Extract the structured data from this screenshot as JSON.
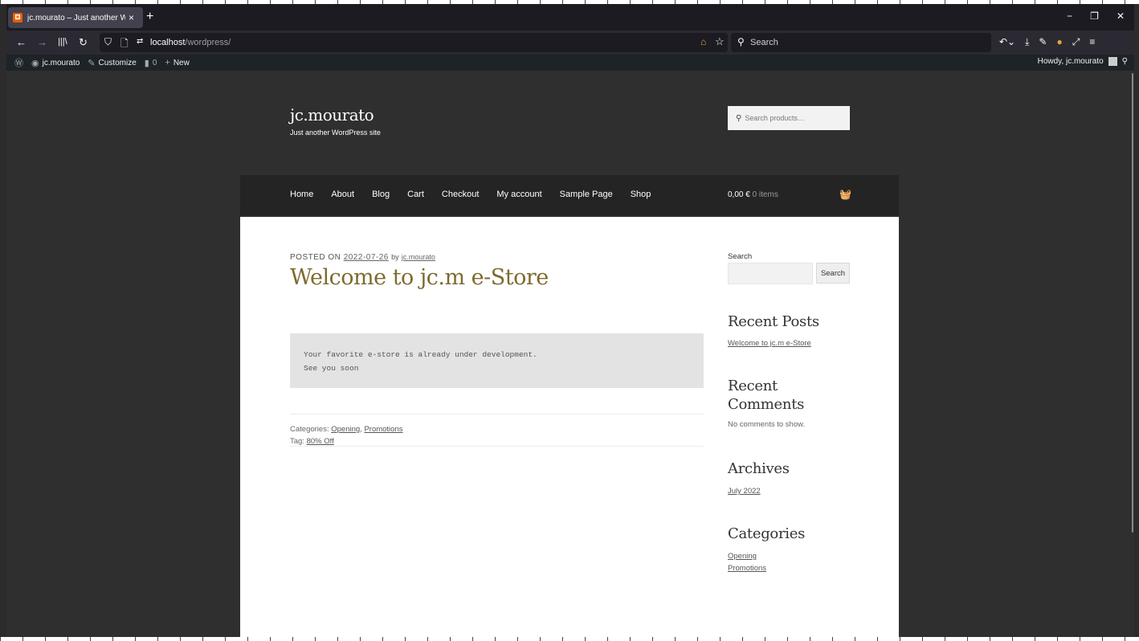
{
  "browser": {
    "tab_title": "jc.mourato – Just another Word",
    "tab_close": "×",
    "new_tab": "+",
    "url_host": "localhost",
    "url_path": "/wordpress/",
    "search_placeholder": "Search"
  },
  "admin_bar": {
    "site_name": "jc.mourato",
    "customize": "Customize",
    "comments_count": "0",
    "new_label": "New",
    "howdy": "Howdy, jc.mourato"
  },
  "site": {
    "title": "jc.mourato",
    "description": "Just another WordPress site",
    "product_search_placeholder": "Search products…"
  },
  "menu": {
    "items": [
      "Home",
      "About",
      "Blog",
      "Cart",
      "Checkout",
      "My account",
      "Sample Page",
      "Shop"
    ],
    "cart_amount": "0,00 €",
    "cart_items": "0 items"
  },
  "post": {
    "posted_on_label": "POSTED ON",
    "date": "2022-07-26",
    "by": "by",
    "author": "jc.mourato",
    "title": "Welcome to jc.m e-Store",
    "code_line1": "Your favorite e-store is already under development.",
    "code_line2": "See you soon",
    "categories_label": "Categories:",
    "category1": "Opening",
    "comma": ",",
    "category2": "Promotions",
    "tag_label": "Tag:",
    "tag1": "80% Off"
  },
  "sidebar": {
    "search_label": "Search",
    "search_button": "Search",
    "recent_posts_title": "Recent Posts",
    "recent_post1": "Welcome to jc.m e-Store",
    "recent_comments_title_line1": "Recent",
    "recent_comments_title_line2": "Comments",
    "no_comments": "No comments to show.",
    "archives_title": "Archives",
    "archive1": "July 2022",
    "categories_title": "Categories",
    "category1": "Opening",
    "category2": "Promotions"
  }
}
